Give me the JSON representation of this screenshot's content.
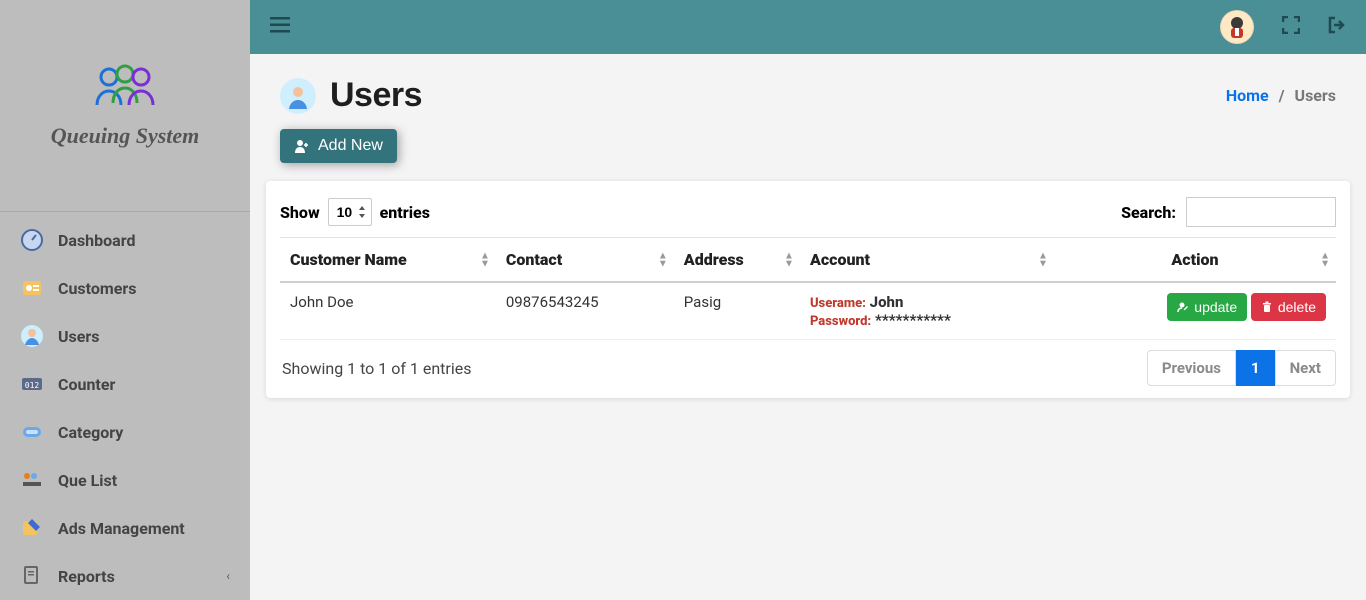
{
  "app": {
    "name": "Queuing System"
  },
  "sidebar": {
    "items": [
      {
        "icon": "dashboard",
        "label": "Dashboard"
      },
      {
        "icon": "customers",
        "label": "Customers"
      },
      {
        "icon": "users",
        "label": "Users"
      },
      {
        "icon": "counter",
        "label": "Counter"
      },
      {
        "icon": "category",
        "label": "Category"
      },
      {
        "icon": "quelist",
        "label": "Que List"
      },
      {
        "icon": "ads",
        "label": "Ads Management"
      },
      {
        "icon": "reports",
        "label": "Reports",
        "chevron": true
      }
    ]
  },
  "breadcrumb": {
    "home": "Home",
    "current": "Users",
    "sep": "/"
  },
  "page": {
    "title": "Users"
  },
  "toolbar": {
    "add_new": "Add New"
  },
  "datatable": {
    "show_label": "Show",
    "entries_label": "entries",
    "length_value": "10",
    "search_label": "Search:",
    "search_value": "",
    "columns": [
      "Customer Name",
      "Contact",
      "Address",
      "Account",
      "Action"
    ],
    "rows": [
      {
        "name": "John Doe",
        "contact": "09876543245",
        "address": "Pasig",
        "account": {
          "username_label": "Userame:",
          "username": "John",
          "password_label": "Password:",
          "password": "***********"
        }
      }
    ],
    "info": "Showing 1 to 1 of 1 entries",
    "pagination": {
      "previous": "Previous",
      "pages": [
        "1"
      ],
      "next": "Next",
      "active_page": "1"
    },
    "row_actions": {
      "update": "update",
      "delete": "delete"
    }
  }
}
